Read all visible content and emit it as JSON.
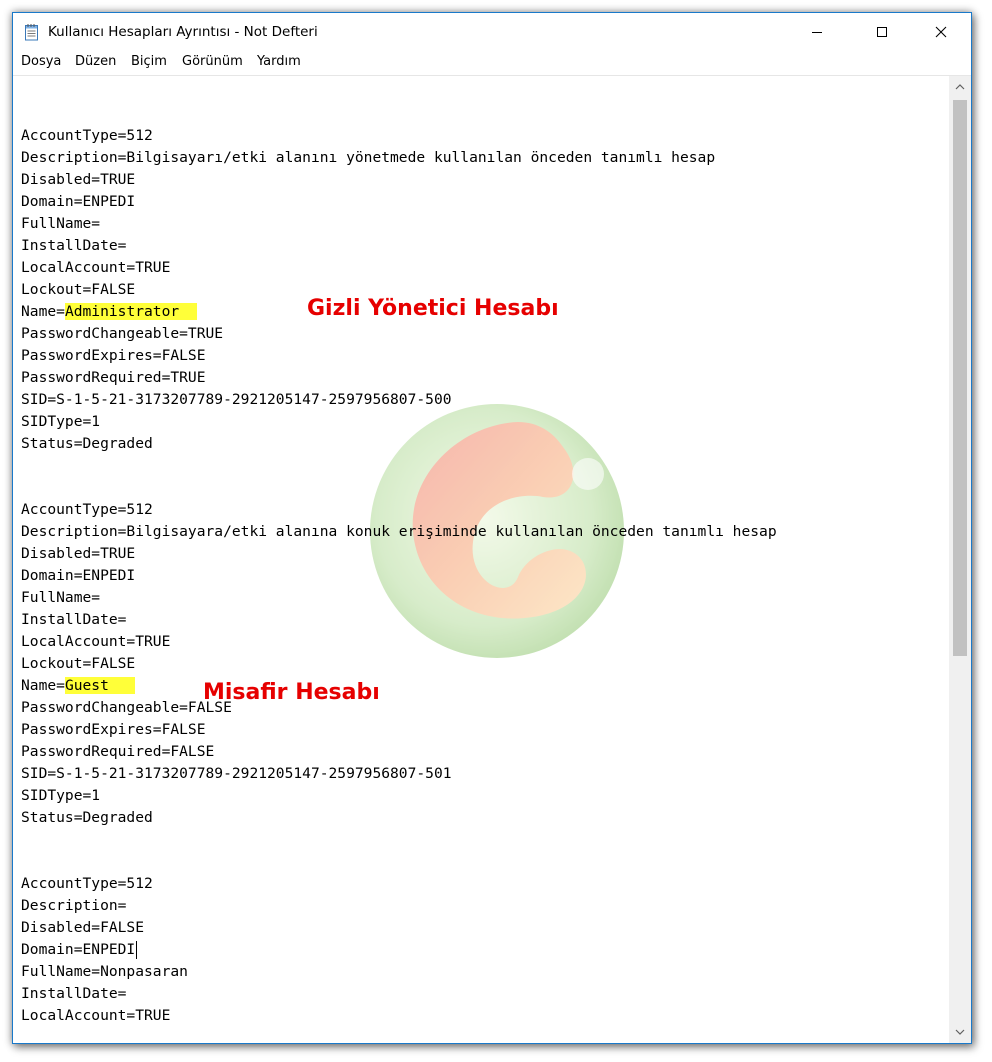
{
  "window": {
    "title": "Kullanıcı Hesapları Ayrıntısı - Not Defteri",
    "controls": {
      "minimize": "minimize",
      "maximize": "maximize",
      "close": "close"
    }
  },
  "menu": [
    {
      "label": "Dosya"
    },
    {
      "label": "Düzen"
    },
    {
      "label": "Biçim"
    },
    {
      "label": "Görünüm"
    },
    {
      "label": "Yardım"
    }
  ],
  "accounts": [
    {
      "account_type": "AccountType=512",
      "description": "Description=Bilgisayarı/etki alanını yönetmede kullanılan önceden tanımlı hesap",
      "disabled": "Disabled=TRUE",
      "domain": "Domain=ENPEDI",
      "full_name": "FullName=",
      "install_date": "InstallDate=",
      "local_account": "LocalAccount=TRUE",
      "lockout": "Lockout=FALSE",
      "name_key": "Name=",
      "name_value": "Administrator",
      "password_changeable": "PasswordChangeable=TRUE",
      "password_expires": "PasswordExpires=FALSE",
      "password_required": "PasswordRequired=TRUE",
      "sid": "SID=S-1-5-21-3173207789-2921205147-2597956807-500",
      "sid_type": "SIDType=1",
      "status": "Status=Degraded"
    },
    {
      "account_type": "AccountType=512",
      "description": "Description=Bilgisayara/etki alanına konuk erişiminde kullanılan önceden tanımlı hesap",
      "disabled": "Disabled=TRUE",
      "domain": "Domain=ENPEDI",
      "full_name": "FullName=",
      "install_date": "InstallDate=",
      "local_account": "LocalAccount=TRUE",
      "lockout": "Lockout=FALSE",
      "name_key": "Name=",
      "name_value": "Guest",
      "password_changeable": "PasswordChangeable=FALSE",
      "password_expires": "PasswordExpires=FALSE",
      "password_required": "PasswordRequired=FALSE",
      "sid": "SID=S-1-5-21-3173207789-2921205147-2597956807-501",
      "sid_type": "SIDType=1",
      "status": "Status=Degraded"
    },
    {
      "account_type": "AccountType=512",
      "description": "Description=",
      "disabled": "Disabled=FALSE",
      "domain": "Domain=ENPEDI",
      "full_name": "FullName=Nonpasaran",
      "install_date": "InstallDate=",
      "local_account": "LocalAccount=TRUE"
    }
  ],
  "annotations": {
    "admin_label": "Gizli Yönetici Hesabı",
    "guest_label": "Misafir Hesabı"
  },
  "colors": {
    "highlight": "#ffff39",
    "annotation_red": "#e60000",
    "window_border": "#1979ca"
  },
  "icons": {
    "app": "notepad-icon",
    "scroll_up": "chevron-up-icon",
    "scroll_down": "chevron-down-icon"
  }
}
